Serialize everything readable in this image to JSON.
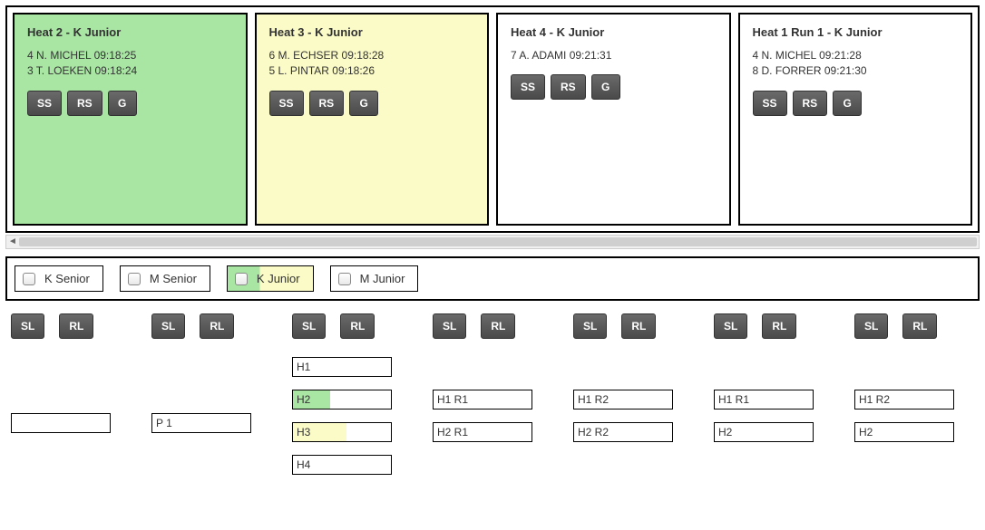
{
  "heats": [
    {
      "title": "Heat 2 - K Junior",
      "bg": "green",
      "lines": [
        "4 N. MICHEL 09:18:25",
        "3 T. LOEKEN 09:18:24"
      ]
    },
    {
      "title": "Heat 3 - K Junior",
      "bg": "yellow",
      "lines": [
        "6 M. ECHSER 09:18:28",
        "5 L. PINTAR 09:18:26"
      ]
    },
    {
      "title": "Heat 4 - K Junior",
      "bg": "white",
      "lines": [
        "7 A. ADAMI 09:21:31"
      ]
    },
    {
      "title": "Heat 1 Run 1 - K Junior",
      "bg": "white",
      "lines": [
        "4 N. MICHEL 09:21:28",
        "8 D. FORRER 09:21:30"
      ]
    }
  ],
  "heat_buttons": {
    "ss": "SS",
    "rs": "RS",
    "g": "G"
  },
  "filters": [
    {
      "label": "K Senior",
      "active": false
    },
    {
      "label": "M Senior",
      "active": false
    },
    {
      "label": "K Junior",
      "active": true
    },
    {
      "label": "M Junior",
      "active": false
    }
  ],
  "lane_buttons": {
    "sl": "SL",
    "rl": "RL"
  },
  "columns": [
    {
      "cells": [
        {
          "label": "",
          "kind": "empty"
        }
      ]
    },
    {
      "cells": [
        {
          "label": "P 1"
        }
      ]
    },
    {
      "cells": [
        {
          "label": "H1"
        },
        {
          "label": "H2",
          "fill": "h2"
        },
        {
          "label": "H3",
          "fill": "h3"
        },
        {
          "label": "H4"
        }
      ]
    },
    {
      "cells": [
        {
          "label": "H1 R1"
        },
        {
          "label": "H2 R1"
        }
      ]
    },
    {
      "cells": [
        {
          "label": "H1 R2"
        },
        {
          "label": "H2 R2"
        }
      ]
    },
    {
      "cells": [
        {
          "label": "H1 R1"
        },
        {
          "label": "H2"
        }
      ]
    },
    {
      "cells": [
        {
          "label": "H1 R2"
        },
        {
          "label": "H2"
        }
      ]
    }
  ]
}
